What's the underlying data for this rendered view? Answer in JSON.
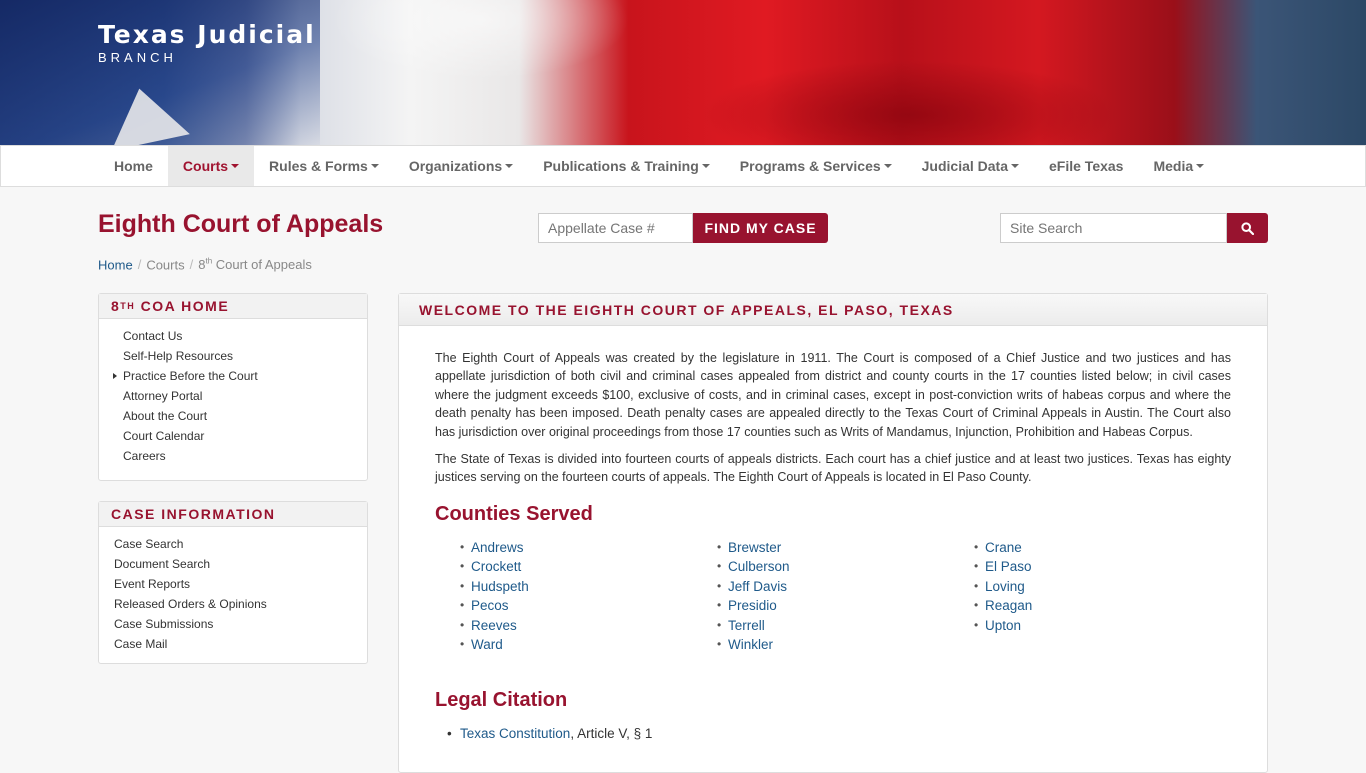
{
  "brand": {
    "title": "Texas Judicial",
    "subtitle": "BRANCH"
  },
  "nav": [
    {
      "label": "Home",
      "dropdown": false,
      "active": false
    },
    {
      "label": "Courts",
      "dropdown": true,
      "active": true
    },
    {
      "label": "Rules & Forms",
      "dropdown": true,
      "active": false
    },
    {
      "label": "Organizations",
      "dropdown": true,
      "active": false
    },
    {
      "label": "Publications & Training",
      "dropdown": true,
      "active": false
    },
    {
      "label": "Programs & Services",
      "dropdown": true,
      "active": false
    },
    {
      "label": "Judicial Data",
      "dropdown": true,
      "active": false
    },
    {
      "label": "eFile Texas",
      "dropdown": false,
      "active": false
    },
    {
      "label": "Media",
      "dropdown": true,
      "active": false
    }
  ],
  "page": {
    "title": "Eighth Court of Appeals"
  },
  "case_search": {
    "placeholder": "Appellate Case #",
    "button": "FIND MY CASE"
  },
  "site_search": {
    "placeholder": "Site Search"
  },
  "breadcrumb": {
    "home": "Home",
    "courts": "Courts",
    "current_num": "8",
    "current_sup": "th",
    "current_rest": " Court of Appeals"
  },
  "sidebar": {
    "coa": {
      "heading_num": "8",
      "heading_sup": "TH",
      "heading_rest": " COA HOME",
      "items": [
        "Contact Us",
        "Self-Help Resources",
        "Practice Before the Court",
        "Attorney Portal",
        "About the Court",
        "Court Calendar",
        "Careers"
      ]
    },
    "case_info": {
      "heading": "CASE INFORMATION",
      "items": [
        "Case Search",
        "Document Search",
        "Event Reports",
        "Released Orders & Opinions",
        "Case Submissions",
        "Case Mail"
      ]
    }
  },
  "main": {
    "heading": "WELCOME TO THE EIGHTH COURT OF APPEALS, EL PASO, TEXAS",
    "para1": "The Eighth Court of Appeals was created by the legislature in 1911. The Court is composed of a Chief Justice and two justices and has appellate jurisdiction of both civil and criminal cases appealed from district and county courts in the 17 counties listed below; in civil cases where the judgment exceeds $100, exclusive of costs, and in criminal cases, except in post-conviction writs of habeas corpus and where the death penalty has been imposed. Death penalty cases are appealed directly to the Texas Court of Criminal Appeals in Austin. The Court also has jurisdiction over original proceedings from those 17 counties such as Writs of Mandamus, Injunction, Prohibition and Habeas Corpus.",
    "para2": "The State of Texas is divided into fourteen courts of appeals districts. Each court has a chief justice and at least two justices. Texas has eighty justices serving on the fourteen courts of appeals. The Eighth Court of Appeals is located in El Paso County.",
    "counties_heading": "Counties Served",
    "counties_cols": [
      [
        "Andrews",
        "Crockett",
        "Hudspeth",
        "Pecos",
        "Reeves",
        "Ward"
      ],
      [
        "Brewster",
        "Culberson",
        "Jeff Davis",
        "Presidio",
        "Terrell",
        "Winkler"
      ],
      [
        "Crane",
        "El Paso",
        "Loving",
        "Reagan",
        "Upton"
      ]
    ],
    "legal_heading": "Legal Citation",
    "legal_link": "Texas Constitution",
    "legal_rest": ", Article V, § 1"
  },
  "colors": {
    "accent": "#98132f",
    "link": "#1f5a8a"
  }
}
